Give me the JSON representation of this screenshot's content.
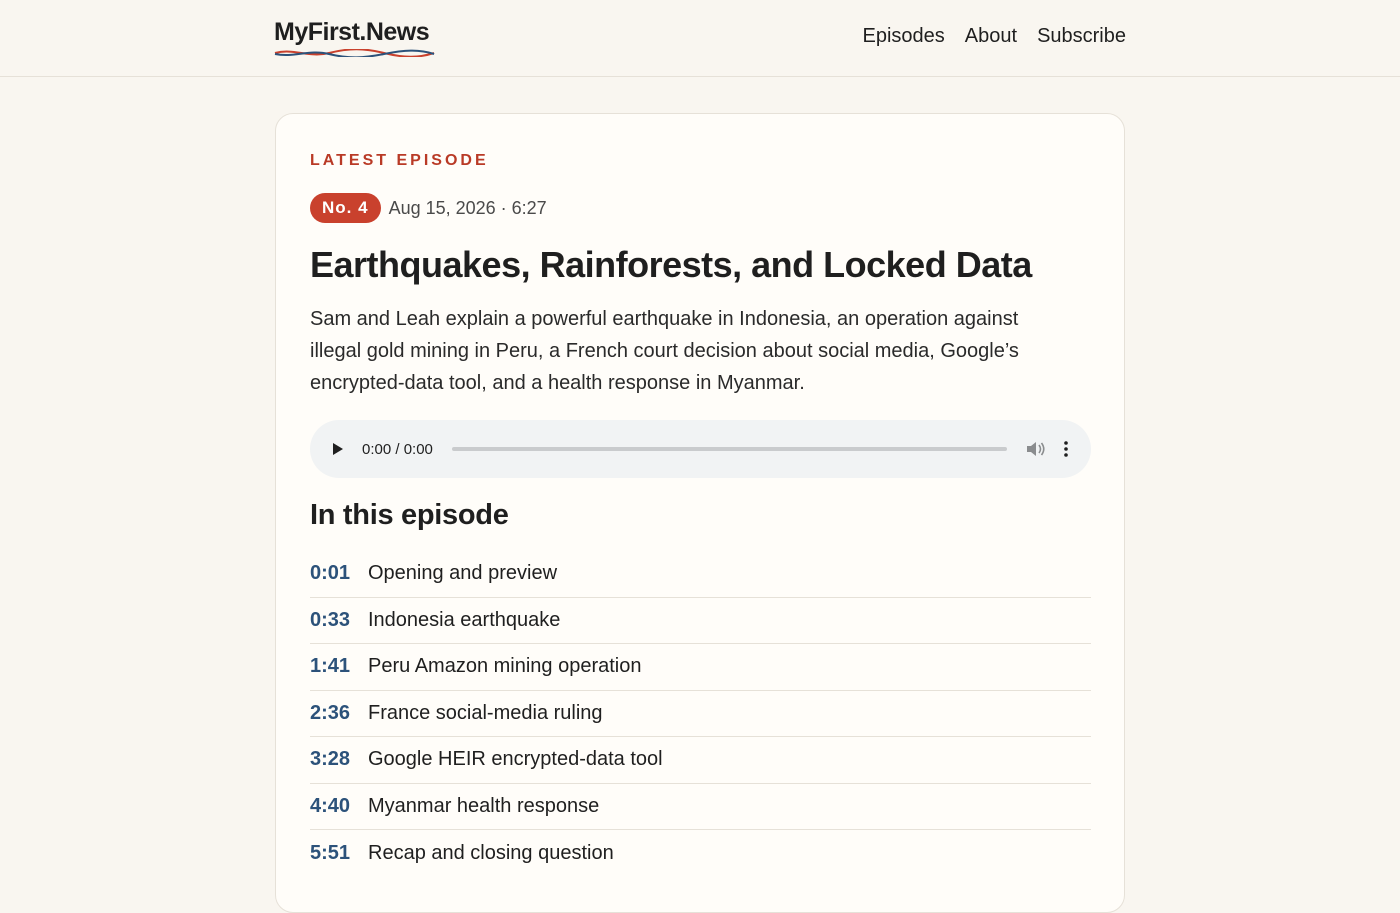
{
  "header": {
    "logo": "MyFirst.News",
    "nav": [
      "Episodes",
      "About",
      "Subscribe"
    ]
  },
  "episode": {
    "eyebrow": "LATEST EPISODE",
    "number": "No. 4",
    "date_duration": "Aug 15, 2026 · 6:27",
    "title": "Earthquakes, Rainforests, and Locked Data",
    "description": "Sam and Leah explain a powerful earthquake in Indonesia, an operation against illegal gold mining in Peru, a French court decision about social media, Google’s encrypted-data tool, and a health response in Myanmar."
  },
  "player": {
    "time": "0:00 / 0:00",
    "progress": 0
  },
  "chapters": {
    "heading": "In this episode",
    "items": [
      {
        "time": "0:01",
        "title": "Opening and preview"
      },
      {
        "time": "0:33",
        "title": "Indonesia earthquake"
      },
      {
        "time": "1:41",
        "title": "Peru Amazon mining operation"
      },
      {
        "time": "2:36",
        "title": "France social-media ruling"
      },
      {
        "time": "3:28",
        "title": "Google HEIR encrypted-data tool"
      },
      {
        "time": "4:40",
        "title": "Myanmar health response"
      },
      {
        "time": "5:51",
        "title": "Recap and closing question"
      }
    ]
  },
  "colors": {
    "accent": "#c9412d",
    "link": "#2c527a",
    "logo_wave_red": "#c9412d",
    "logo_wave_blue": "#2c527a"
  }
}
